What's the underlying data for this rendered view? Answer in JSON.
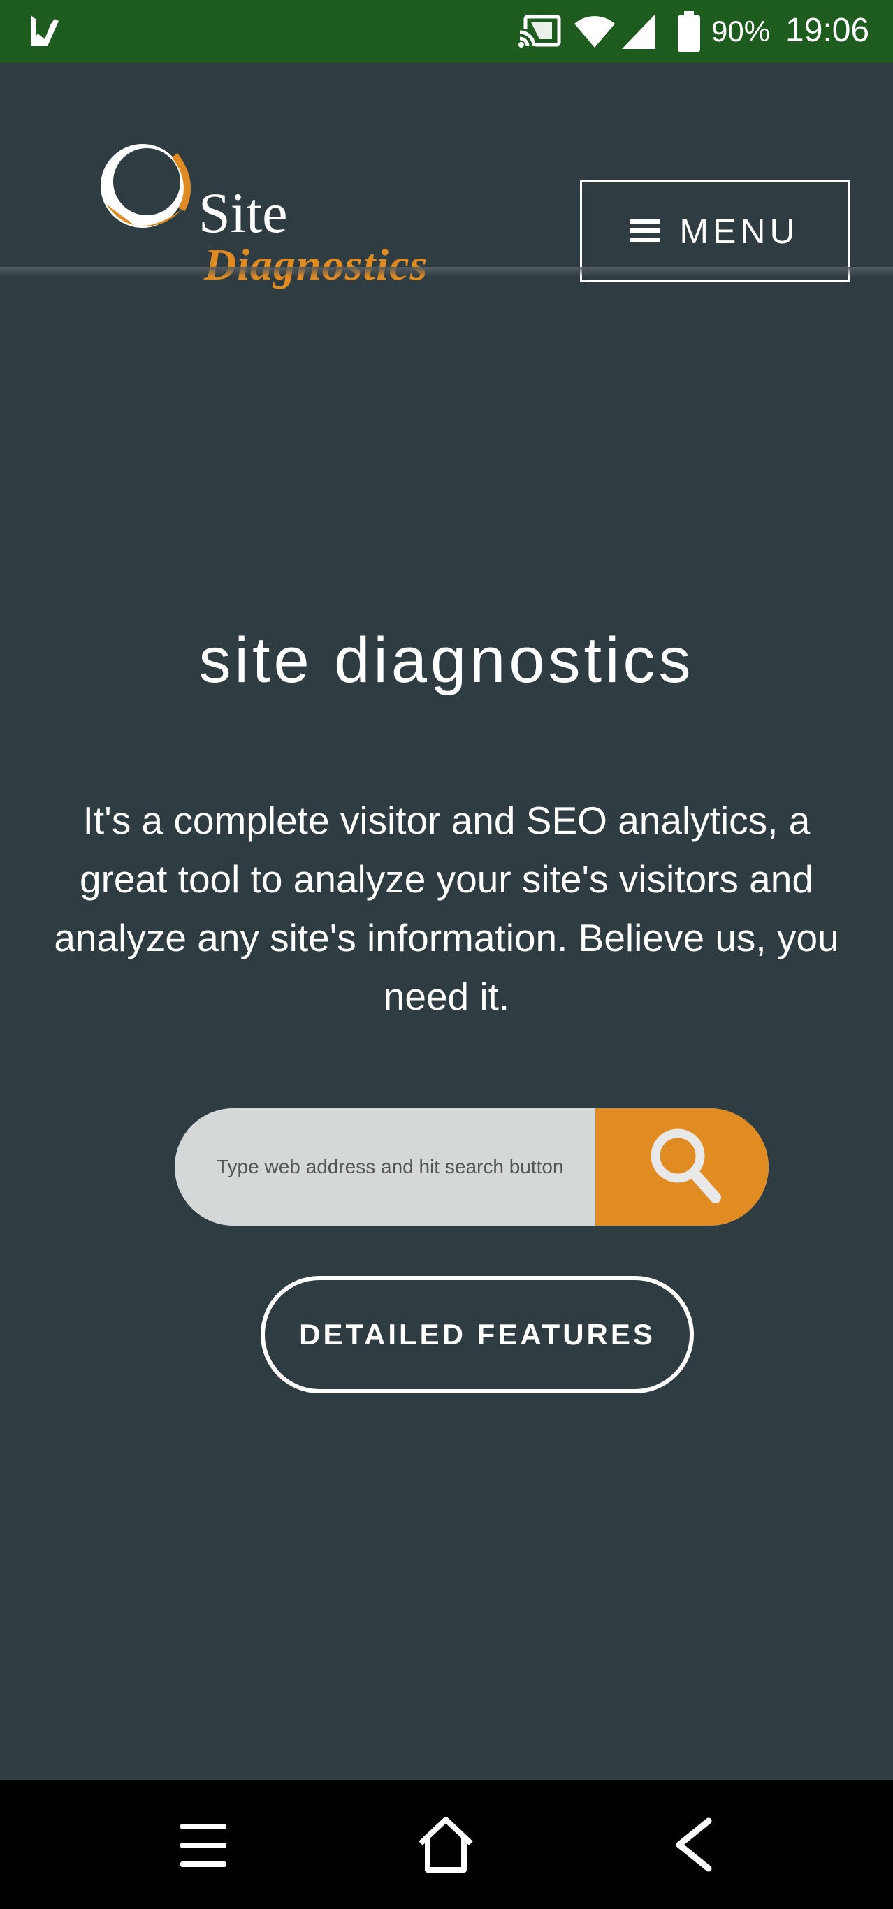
{
  "status_bar": {
    "battery": "90%",
    "time": "19:06",
    "icons": [
      "app-notification-icon",
      "cast-icon",
      "wifi-icon",
      "cell-signal-icon",
      "battery-icon"
    ]
  },
  "header": {
    "logo": {
      "line1": "Site",
      "line2": "Diagnostics"
    },
    "menu_label": "MENU"
  },
  "hero": {
    "title": "site diagnostics",
    "description": "It's a complete visitor and SEO analytics, a great tool to analyze your site's visitors and analyze any site's information. Believe us, you need it.",
    "search": {
      "placeholder": "Type web address and hit search button",
      "value": ""
    },
    "features_label": "DETAILED FEATURES"
  },
  "colors": {
    "status_bar": "#1e5b1e",
    "background": "#2f3d42",
    "accent": "#e08c22",
    "search_field": "#d5d8d9",
    "nav_bar": "#000000"
  },
  "nav_bar": {
    "icons": [
      "recents-icon",
      "home-icon",
      "back-icon"
    ]
  }
}
